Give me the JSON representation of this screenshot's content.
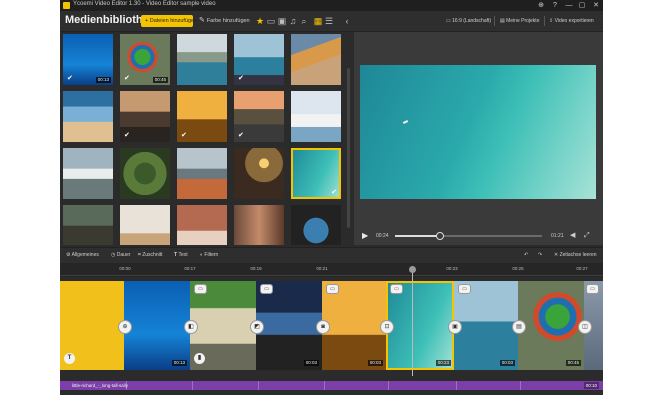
{
  "window": {
    "title": "Ycoemi Video Editor 1.30 - Video Editor sample video",
    "controls": [
      "⊕",
      "?",
      "—",
      "▢",
      "✕"
    ]
  },
  "toolbar": {
    "page_title": "Medienbibliothek",
    "add_files_label": "+ Dateien hinzufügen",
    "add_color_label": "Farbe hinzufügen",
    "aspect_label": "16:9 (Landschaft)",
    "projects_label": "Meine Projekte",
    "export_label": "Video exportieren"
  },
  "media": {
    "items": [
      {
        "duration": "00:13",
        "checked": true
      },
      {
        "duration": "00:45",
        "checked": true
      },
      {
        "duration": "",
        "checked": false
      },
      {
        "duration": "",
        "checked": true
      },
      {
        "duration": "",
        "checked": false
      },
      {
        "duration": "",
        "checked": false
      },
      {
        "duration": "",
        "checked": true
      },
      {
        "duration": "",
        "checked": true
      },
      {
        "duration": "",
        "checked": true
      },
      {
        "duration": "",
        "checked": false
      },
      {
        "duration": "",
        "checked": false
      },
      {
        "duration": "",
        "checked": false
      },
      {
        "duration": "",
        "checked": false
      },
      {
        "duration": "",
        "checked": false
      },
      {
        "duration": "",
        "checked": true
      },
      {
        "duration": "",
        "checked": false
      },
      {
        "duration": "",
        "checked": false
      },
      {
        "duration": "",
        "checked": false
      },
      {
        "duration": "",
        "checked": false
      },
      {
        "duration": "",
        "checked": false
      }
    ]
  },
  "preview": {
    "current_time": "00:24",
    "total_time": "01:21",
    "progress": 0.3
  },
  "edit_tools": {
    "general": "Allgemeines",
    "duration": "Dauer",
    "crop": "Zuschnitt",
    "text": "Text",
    "filters": "Filtern",
    "zoom_label": "Zoom fit",
    "timeline_label": "Zeitachse leeren"
  },
  "ruler": {
    "ticks": [
      "00:00",
      "00:17",
      "00:19",
      "00:21",
      "00:23",
      "00:25",
      "00:27",
      "01:11"
    ]
  },
  "timeline": {
    "clips": [
      {
        "duration": ""
      },
      {
        "duration": "00:13"
      },
      {
        "duration": ""
      },
      {
        "duration": "00:03"
      },
      {
        "duration": "00:03"
      },
      {
        "duration": "00:23"
      },
      {
        "duration": "00:03"
      },
      {
        "duration": "00:45"
      },
      {
        "duration": ""
      }
    ]
  },
  "audio": {
    "label": "little-richard_-_long-tall-sally",
    "duration": "00:10"
  },
  "colors": {
    "accent": "#f5c400",
    "background": "#2b2b2b",
    "audio_track": "#7c3fa9"
  }
}
